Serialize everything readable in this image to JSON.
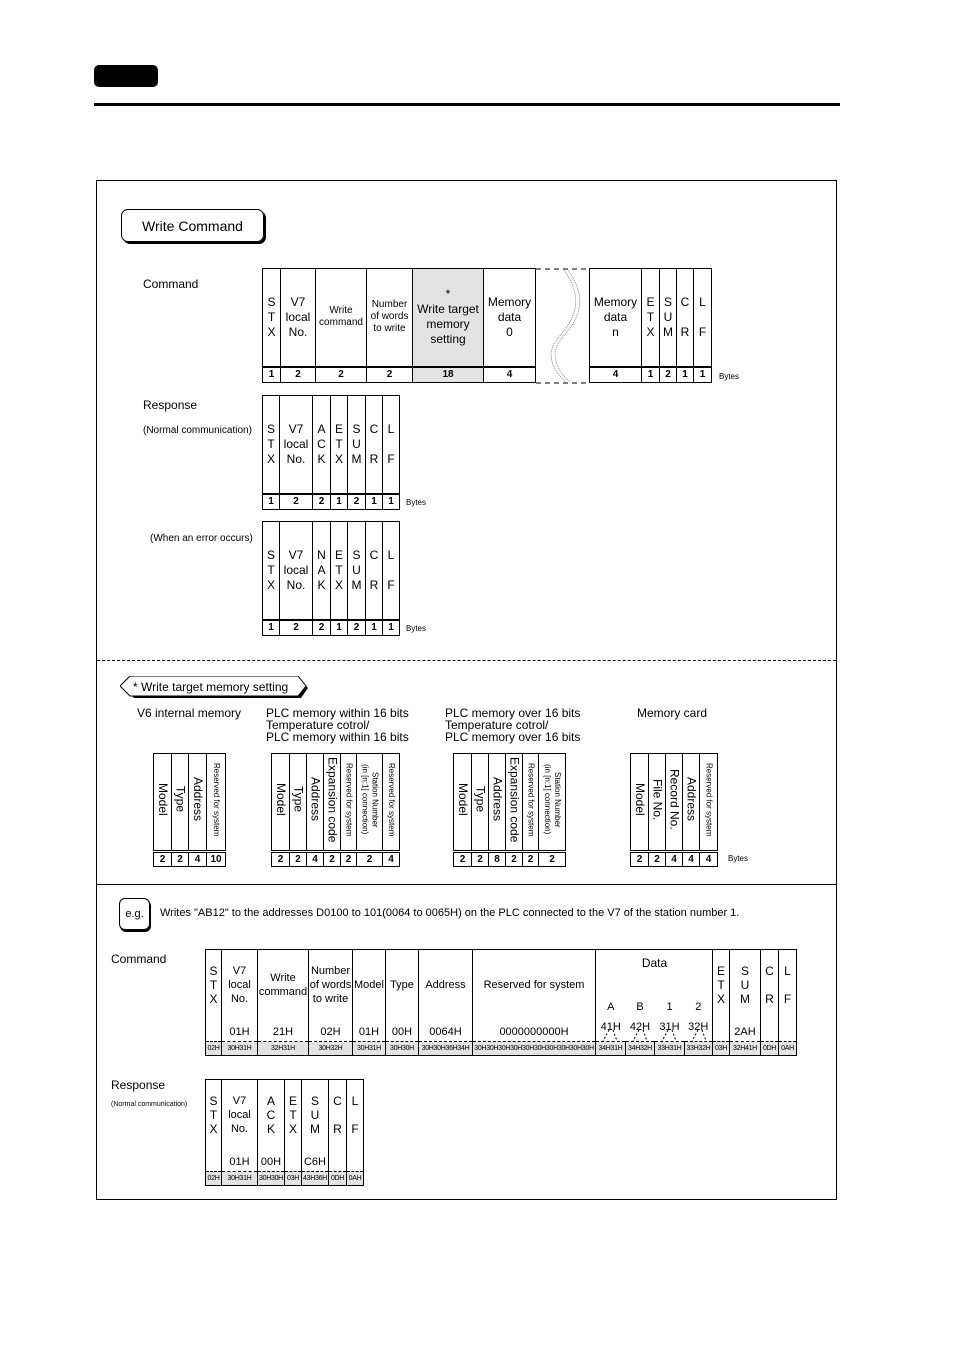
{
  "page": {
    "section_title": "Write Command",
    "write_command_cmd_label": "Command",
    "response_label": "Response",
    "normal_comm_label": "(Normal communication)",
    "error_label": "(When an error occurs)",
    "bytes_unit": "Bytes"
  },
  "command": {
    "fields": [
      {
        "label": "S\nT\nX",
        "bytes": "1"
      },
      {
        "label": "V7\nlocal\nNo.",
        "bytes": "2"
      },
      {
        "label": "Write\ncommand",
        "bytes": "2"
      },
      {
        "label": "Number\nof words\nto write",
        "bytes": "2"
      },
      {
        "label": "*\nWrite target\nmemory\nsetting",
        "bytes": "18"
      },
      {
        "label": "Memory\ndata\n0",
        "bytes": "4"
      }
    ],
    "fields_tail": [
      {
        "label": "Memory\ndata\nn",
        "bytes": "4"
      },
      {
        "label": "E\nT\nX",
        "bytes": "1"
      },
      {
        "label": "S\nU\nM",
        "bytes": "2"
      },
      {
        "label": "C\n\nR",
        "bytes": "1"
      },
      {
        "label": "L\n\nF",
        "bytes": "1"
      }
    ]
  },
  "response_normal": {
    "fields": [
      {
        "label": "S\nT\nX",
        "bytes": "1"
      },
      {
        "label": "V7\nlocal\nNo.",
        "bytes": "2"
      },
      {
        "label": "A\nC\nK",
        "bytes": "2"
      },
      {
        "label": "E\nT\nX",
        "bytes": "1"
      },
      {
        "label": "S\nU\nM",
        "bytes": "2"
      },
      {
        "label": "C\n\nR",
        "bytes": "1"
      },
      {
        "label": "L\n\nF",
        "bytes": "1"
      }
    ]
  },
  "response_error": {
    "fields": [
      {
        "label": "S\nT\nX",
        "bytes": "1"
      },
      {
        "label": "V7\nlocal\nNo.",
        "bytes": "2"
      },
      {
        "label": "N\nA\nK",
        "bytes": "2"
      },
      {
        "label": "E\nT\nX",
        "bytes": "1"
      },
      {
        "label": "S\nU\nM",
        "bytes": "2"
      },
      {
        "label": "C\n\nR",
        "bytes": "1"
      },
      {
        "label": "L\n\nF",
        "bytes": "1"
      }
    ]
  },
  "memory_setting": {
    "tag": "* Write target memory setting",
    "groups": [
      {
        "title": "V6 internal memory",
        "fields": [
          {
            "label": "Model",
            "bytes": "2"
          },
          {
            "label": "Type",
            "bytes": "2"
          },
          {
            "label": "Address",
            "bytes": "4"
          },
          {
            "label": "Reserved for system",
            "bytes": "10",
            "small": true
          }
        ]
      },
      {
        "title": "PLC memory within 16 bits\nTemperature cotrol/\nPLC memory within 16 bits",
        "fields": [
          {
            "label": "Model",
            "bytes": "2"
          },
          {
            "label": "Type",
            "bytes": "2"
          },
          {
            "label": "Address",
            "bytes": "4"
          },
          {
            "label": "Expansion code",
            "bytes": "2"
          },
          {
            "label": "Reserved for system",
            "bytes": "2",
            "small": true
          },
          {
            "label": "Station Number\n(in [n:1] connection)",
            "bytes": "2",
            "small": true
          },
          {
            "label": "Reserved for system",
            "bytes": "4",
            "small": true
          }
        ]
      },
      {
        "title": "PLC memory over 16 bits\nTemperature cotrol/\nPLC memory over 16 bits",
        "fields": [
          {
            "label": "Model",
            "bytes": "2"
          },
          {
            "label": "Type",
            "bytes": "2"
          },
          {
            "label": "Address",
            "bytes": "8"
          },
          {
            "label": "Expansion code",
            "bytes": "2"
          },
          {
            "label": "Reserved for system",
            "bytes": "2",
            "small": true
          },
          {
            "label": "Station Number\n(in [n:1] connection)",
            "bytes": "2",
            "small": true
          }
        ]
      },
      {
        "title": "Memory card",
        "fields": [
          {
            "label": "Model",
            "bytes": "2"
          },
          {
            "label": "File No.",
            "bytes": "2"
          },
          {
            "label": "Record No.",
            "bytes": "4"
          },
          {
            "label": "Address",
            "bytes": "4"
          },
          {
            "label": "Reserved for system",
            "bytes": "4",
            "small": true
          }
        ]
      }
    ]
  },
  "example": {
    "badge": "e.g.",
    "description": "Writes \"AB12\" to the addresses D0100 to 101(0064 to 0065H) on the PLC connected to the V7 of the station number 1.",
    "command_label": "Command",
    "response_label": "Response",
    "normal_comm_label": "(Normal communication)",
    "data_header": "Data",
    "command_fields": [
      {
        "label": "S\nT\nX",
        "value": "",
        "hex": "02H"
      },
      {
        "label": "V7\nlocal\nNo.",
        "value": "01H",
        "hex": "30H31H"
      },
      {
        "label": "Write\ncommand",
        "value": "21H",
        "hex": "32H31H"
      },
      {
        "label": "Number\nof words\nto write",
        "value": "02H",
        "hex": "30H32H"
      },
      {
        "label": "Model",
        "value": "01H",
        "hex": "30H31H"
      },
      {
        "label": "Type",
        "value": "00H",
        "hex": "30H30H"
      },
      {
        "label": "Address",
        "value": "0064H",
        "hex": "30H30H36H34H"
      },
      {
        "label": "Reserved for system",
        "value": "0000000000H",
        "hex": "30H30H30H30H30H30H30H30H30H30H"
      },
      {
        "label": "A",
        "value": "41H",
        "hex": "34H31H"
      },
      {
        "label": "B",
        "value": "42H",
        "hex": "34H32H"
      },
      {
        "label": "1",
        "value": "31H",
        "hex": "33H31H"
      },
      {
        "label": "2",
        "value": "32H",
        "hex": "33H32H"
      },
      {
        "label": "E\nT\nX",
        "value": "",
        "hex": "03H"
      },
      {
        "label": "S\nU\nM",
        "value": "2AH",
        "hex": "32H41H"
      },
      {
        "label": "C\n\nR",
        "value": "",
        "hex": "0DH"
      },
      {
        "label": "L\n\nF",
        "value": "",
        "hex": "0AH"
      }
    ],
    "response_fields": [
      {
        "label": "S\nT\nX",
        "value": "",
        "hex": "02H"
      },
      {
        "label": "V7\nlocal\nNo.",
        "value": "01H",
        "hex": "30H31H"
      },
      {
        "label": "A\nC\nK",
        "value": "00H",
        "hex": "30H30H"
      },
      {
        "label": "E\nT\nX",
        "value": "",
        "hex": "03H"
      },
      {
        "label": "S\nU\nM",
        "value": "C6H",
        "hex": "43H36H"
      },
      {
        "label": "C\n\nR",
        "value": "",
        "hex": "0DH"
      },
      {
        "label": "L\n\nF",
        "value": "",
        "hex": "0AH"
      }
    ]
  }
}
